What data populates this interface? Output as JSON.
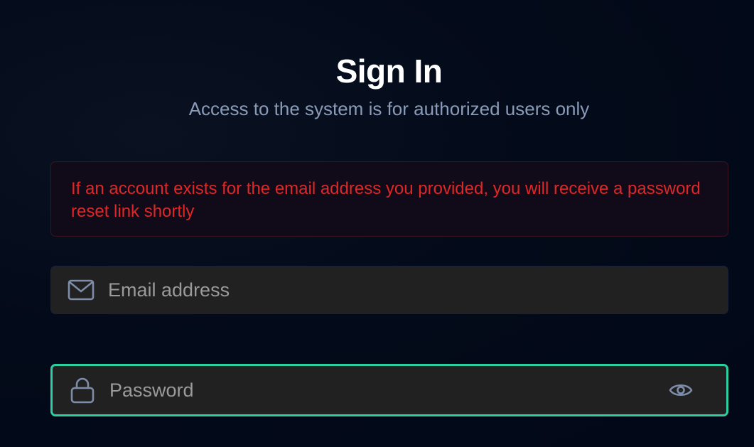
{
  "header": {
    "title": "Sign In",
    "subtitle": "Access to the system is for authorized users only"
  },
  "alert": {
    "message": "If an account exists for the email address you provided, you will receive a password reset link shortly",
    "text_color": "#e02727",
    "border_color": "#3b1520"
  },
  "form": {
    "email": {
      "placeholder": "Email address",
      "value": "",
      "icon": "mail-icon"
    },
    "password": {
      "placeholder": "Password",
      "value": "",
      "icon": "lock-icon",
      "toggle_icon": "eye-icon",
      "focused": true,
      "focus_color": "#2ccfa0"
    }
  },
  "colors": {
    "background": "#020817",
    "field_background": "#212121",
    "icon_color": "#7d8ca8"
  }
}
